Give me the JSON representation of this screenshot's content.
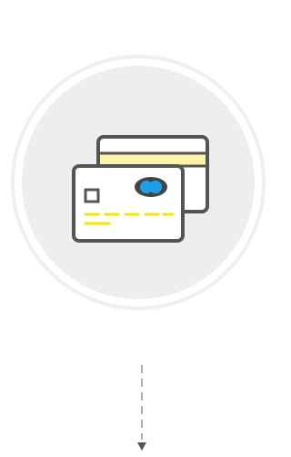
{
  "illustration": {
    "icon": "credit-cards-icon",
    "colors": {
      "outer_ring": "#EFEFEF",
      "inner_disc": "#EEEEEE",
      "outline": "#555555",
      "card_fill": "#FFFFFF",
      "stripe": "#FFF3A8",
      "chip_text_lines": "#F3E600",
      "logo_blue": "#1E9FEA",
      "logo_outline": "#444444"
    }
  },
  "flow_indicator": {
    "icon": "dashed-arrow-down-icon",
    "color": "#888888"
  }
}
